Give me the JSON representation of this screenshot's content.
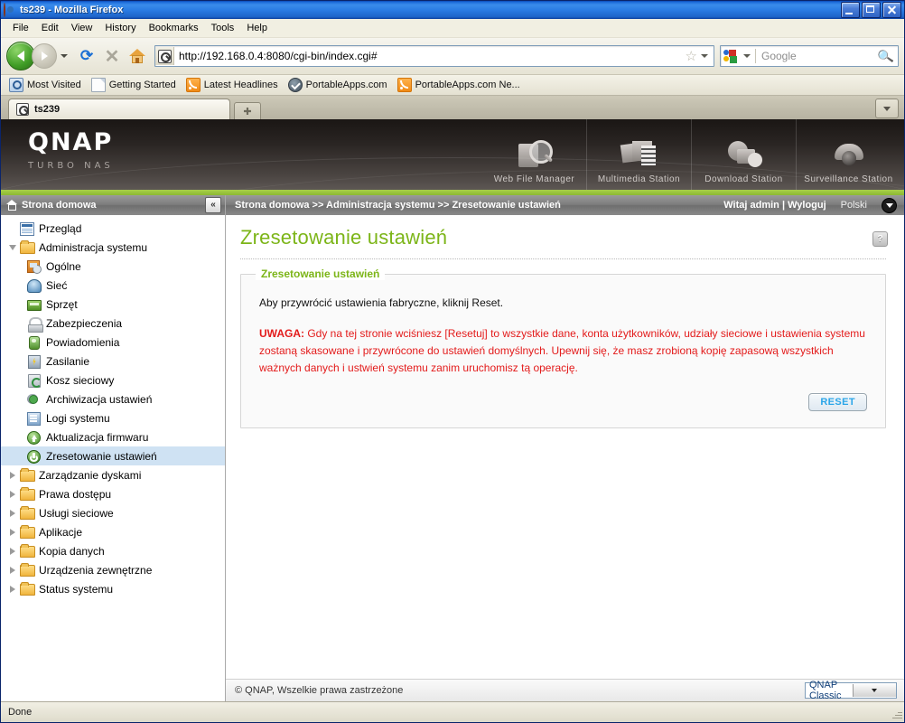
{
  "window": {
    "title": "ts239 - Mozilla Firefox",
    "icon": "firefox-icon",
    "minimize": "minimize",
    "maximize": "maximize",
    "close": "close"
  },
  "menubar": {
    "items": [
      "File",
      "Edit",
      "View",
      "History",
      "Bookmarks",
      "Tools",
      "Help"
    ]
  },
  "toolbar": {
    "back": "Back",
    "forward": "Forward",
    "reload": "⟳",
    "stop": "✕",
    "home": "Home",
    "url": "http://192.168.0.4:8080/cgi-bin/index.cgi#",
    "star": "☆",
    "search_placeholder": "Google",
    "search_engine": "Google",
    "search_icon": "magnifier-icon"
  },
  "bookmarks": [
    {
      "label": "Most Visited",
      "icon": "most-visited-icon"
    },
    {
      "label": "Getting Started",
      "icon": "document-icon"
    },
    {
      "label": "Latest Headlines",
      "icon": "rss-icon"
    },
    {
      "label": "PortableApps.com",
      "icon": "portableapps-icon"
    },
    {
      "label": "PortableApps.com Ne...",
      "icon": "rss-icon"
    }
  ],
  "tabs": {
    "active": "ts239",
    "new_tab": "+",
    "list_button": "tab-list"
  },
  "masthead": {
    "brand": "QNAP",
    "tagline": "TURBO NAS",
    "apps": [
      {
        "label": "Web File Manager",
        "icon": "web-file-manager-icon"
      },
      {
        "label": "Multimedia Station",
        "icon": "multimedia-station-icon"
      },
      {
        "label": "Download Station",
        "icon": "download-station-icon"
      },
      {
        "label": "Surveillance Station",
        "icon": "surveillance-station-icon"
      }
    ]
  },
  "sidebar": {
    "header": "Strona domowa",
    "collapse": "«",
    "items": [
      {
        "label": "Przegląd",
        "icon": "overview-icon",
        "level": 1,
        "twisty": "none",
        "selected": false
      },
      {
        "label": "Administracja systemu",
        "icon": "folder-open-icon",
        "level": 1,
        "twisty": "down",
        "selected": false
      },
      {
        "label": "Ogólne",
        "icon": "general-icon",
        "level": 2,
        "twisty": "none",
        "selected": false
      },
      {
        "label": "Sieć",
        "icon": "network-icon",
        "level": 2,
        "twisty": "none",
        "selected": false
      },
      {
        "label": "Sprzęt",
        "icon": "hardware-icon",
        "level": 2,
        "twisty": "none",
        "selected": false
      },
      {
        "label": "Zabezpieczenia",
        "icon": "security-icon",
        "level": 2,
        "twisty": "none",
        "selected": false
      },
      {
        "label": "Powiadomienia",
        "icon": "notify-icon",
        "level": 2,
        "twisty": "none",
        "selected": false
      },
      {
        "label": "Zasilanie",
        "icon": "power-icon",
        "level": 2,
        "twisty": "none",
        "selected": false
      },
      {
        "label": "Kosz sieciowy",
        "icon": "trash-icon",
        "level": 2,
        "twisty": "none",
        "selected": false
      },
      {
        "label": "Archiwizacja ustawień",
        "icon": "backup-icon",
        "level": 2,
        "twisty": "none",
        "selected": false
      },
      {
        "label": "Logi systemu",
        "icon": "logs-icon",
        "level": 2,
        "twisty": "none",
        "selected": false
      },
      {
        "label": "Aktualizacja firmwaru",
        "icon": "firmware-icon",
        "level": 2,
        "twisty": "none",
        "selected": false
      },
      {
        "label": "Zresetowanie ustawień",
        "icon": "reset-icon",
        "level": 2,
        "twisty": "none",
        "selected": true
      },
      {
        "label": "Zarządzanie dyskami",
        "icon": "folder-icon",
        "level": 1,
        "twisty": "right",
        "selected": false
      },
      {
        "label": "Prawa dostępu",
        "icon": "folder-icon",
        "level": 1,
        "twisty": "right",
        "selected": false
      },
      {
        "label": "Usługi sieciowe",
        "icon": "folder-icon",
        "level": 1,
        "twisty": "right",
        "selected": false
      },
      {
        "label": "Aplikacje",
        "icon": "folder-icon",
        "level": 1,
        "twisty": "right",
        "selected": false
      },
      {
        "label": "Kopia danych",
        "icon": "folder-icon",
        "level": 1,
        "twisty": "right",
        "selected": false
      },
      {
        "label": "Urządzenia zewnętrzne",
        "icon": "folder-icon",
        "level": 1,
        "twisty": "right",
        "selected": false
      },
      {
        "label": "Status systemu",
        "icon": "folder-icon",
        "level": 1,
        "twisty": "right",
        "selected": false
      }
    ]
  },
  "breadcrumb": {
    "text": "Strona domowa >> Administracja systemu >> Zresetowanie ustawień",
    "greeting": "Witaj admin | Wyloguj",
    "language": "Polski"
  },
  "main": {
    "title": "Zresetowanie ustawień",
    "help": "?",
    "panel_legend": "Zresetowanie ustawień",
    "lead": "Aby przywrócić ustawienia fabryczne, kliknij Reset.",
    "warning_label": "UWAGA:",
    "warning_text": " Gdy na tej stronie wciśniesz [Resetuj] to wszystkie dane, konta użytkowników, udziały sieciowe i ustawienia systemu zostaną skasowane i przywrócone do ustawień domyślnych. Upewnij się, że masz zrobioną kopię zapasową wszystkich ważnych danych i ustwień systemu zanim uruchomisz tą operację.",
    "reset_button": "RESET"
  },
  "page_footer": {
    "copyright": "© QNAP, Wszelkie prawa zastrzeżone",
    "theme": "QNAP Classic"
  },
  "statusbar": {
    "text": "Done"
  },
  "colors": {
    "brand_green": "#7cb518",
    "accent_bar": "#8cb932",
    "warning_red": "#e31b1b",
    "reset_blue": "#2aa5e8",
    "selection": "#cfe2f3"
  }
}
